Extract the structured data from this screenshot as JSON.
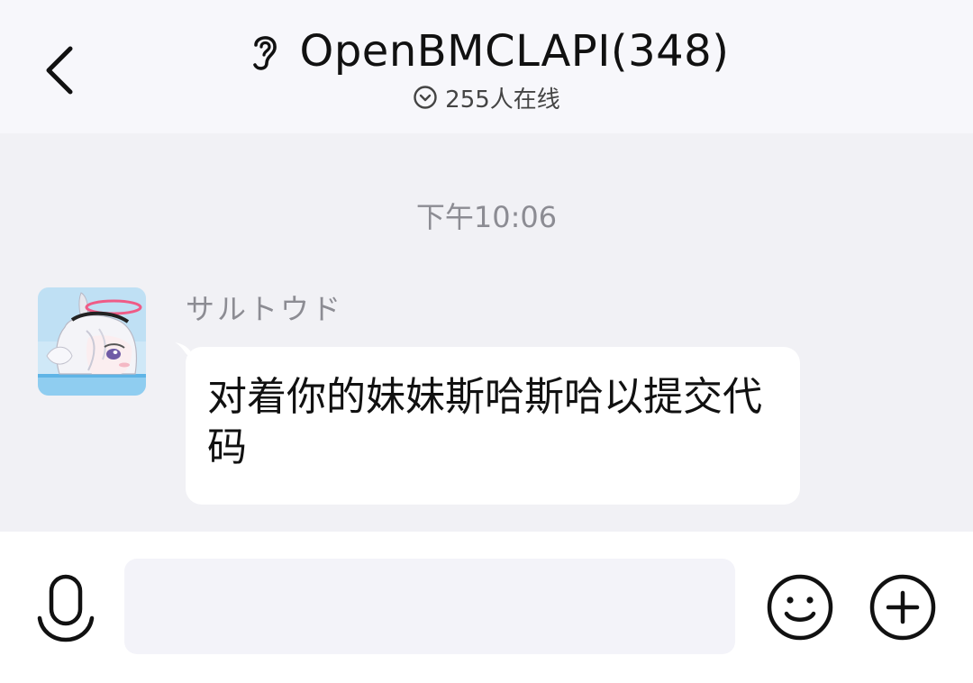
{
  "header": {
    "title": "OpenBMCLAPI(348)",
    "online_count": "255人在线",
    "back_icon": "chevron-left-icon",
    "ear_icon": "ear-icon",
    "online_icon": "chevron-down-circle-icon"
  },
  "chat": {
    "timestamp": "下午10:06",
    "messages": [
      {
        "sender": "サルトウド",
        "text": "对着你的妹妹斯哈斯哈以提交代码",
        "avatar": "anime-avatar"
      }
    ]
  },
  "input_bar": {
    "placeholder": "",
    "value": "",
    "voice_icon": "microphone-icon",
    "emoji_icon": "smiley-icon",
    "plus_icon": "plus-circle-icon"
  },
  "colors": {
    "header_bg": "#f7f7fb",
    "chat_bg": "#f1f1f5",
    "bubble_bg": "#ffffff",
    "muted_text": "#8c8c93"
  }
}
